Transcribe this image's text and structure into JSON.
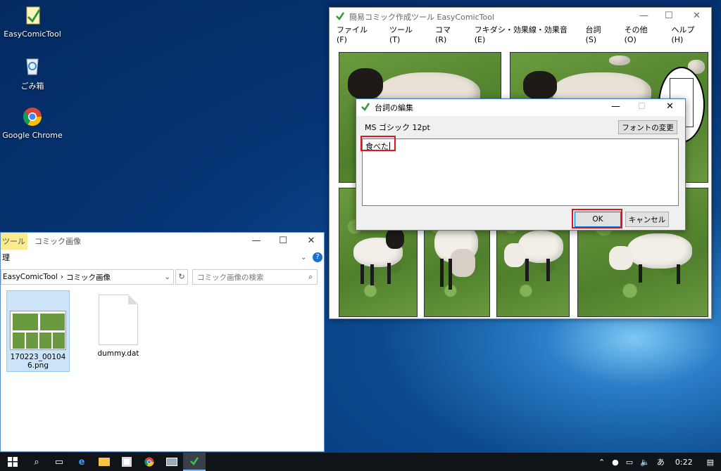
{
  "desktop": {
    "icons": [
      {
        "label": "EasyComicTool"
      },
      {
        "label": "ごみ箱"
      },
      {
        "label": "Google Chrome"
      }
    ]
  },
  "explorer": {
    "title": "コミック画像",
    "ribbon_tab": "ツール",
    "ribbon_sub": "理",
    "address_root": "EasyComicTool",
    "address_sep": "›",
    "address_folder": "コミック画像",
    "search_placeholder": "コミック画像の検索",
    "files": [
      {
        "name": "170223_001046.png"
      },
      {
        "name": "dummy.dat"
      }
    ]
  },
  "comic_window": {
    "title": "簡易コミック作成ツール EasyComicTool",
    "menu": [
      "ファイル(F)",
      "ツール(T)",
      "コマ(R)",
      "フキダシ・効果線・効果音(E)",
      "台詞(S)",
      "その他(O)"
    ],
    "help": "ヘルプ(H)"
  },
  "dialog": {
    "title": "台詞の編集",
    "font_info": "MS ゴシック 12pt",
    "font_button": "フォントの変更",
    "text_value": "食べた",
    "ok_label": "OK",
    "cancel_label": "キャンセル"
  },
  "taskbar": {
    "ime": "あ",
    "time": "0:22"
  },
  "colors": {
    "highlight_red": "#e0141e",
    "dialog_border": "#3c7fc1",
    "ribbon_tab": "#fbeb8c"
  }
}
